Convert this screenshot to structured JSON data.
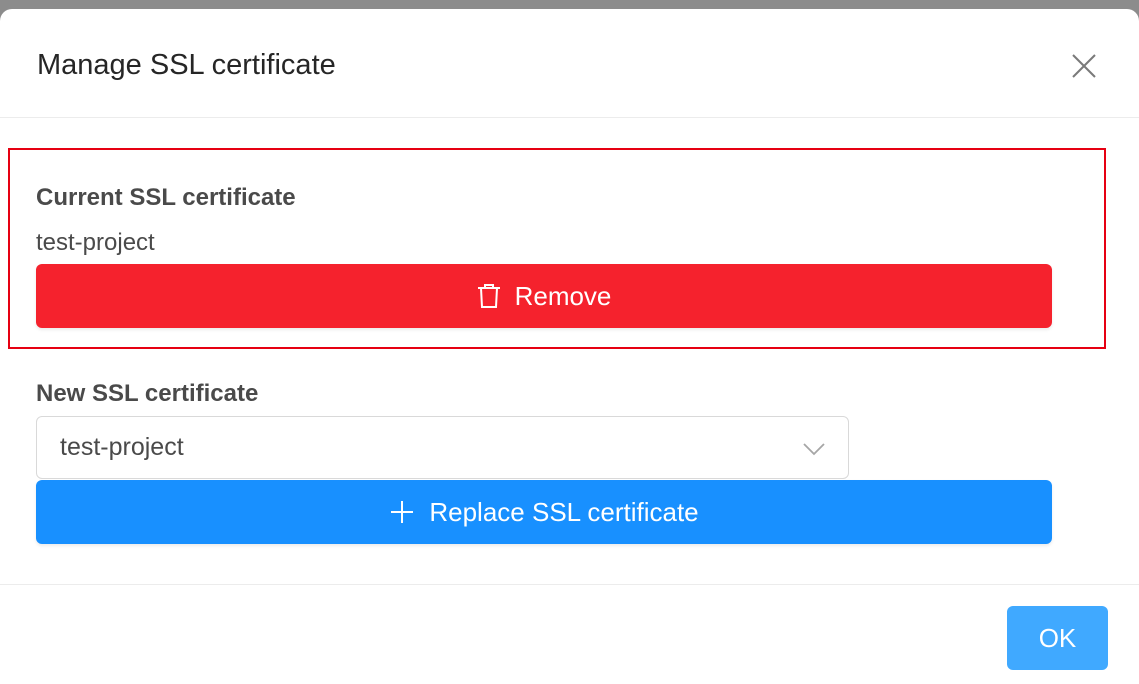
{
  "dialog": {
    "title": "Manage SSL certificate",
    "close_icon": "close-icon"
  },
  "current_certificate": {
    "label": "Current SSL certificate",
    "value": "test-project",
    "remove_button": {
      "label": "Remove",
      "icon": "trash-icon",
      "color": "#f5222d"
    },
    "highlight_color": "#e60012"
  },
  "new_certificate": {
    "label": "New SSL certificate",
    "select_value": "test-project",
    "select_icon": "chevron-down-icon",
    "replace_button": {
      "label": "Replace SSL certificate",
      "icon": "plus-icon",
      "color": "#1890ff"
    }
  },
  "footer": {
    "ok_label": "OK",
    "ok_color": "#40a9ff"
  }
}
